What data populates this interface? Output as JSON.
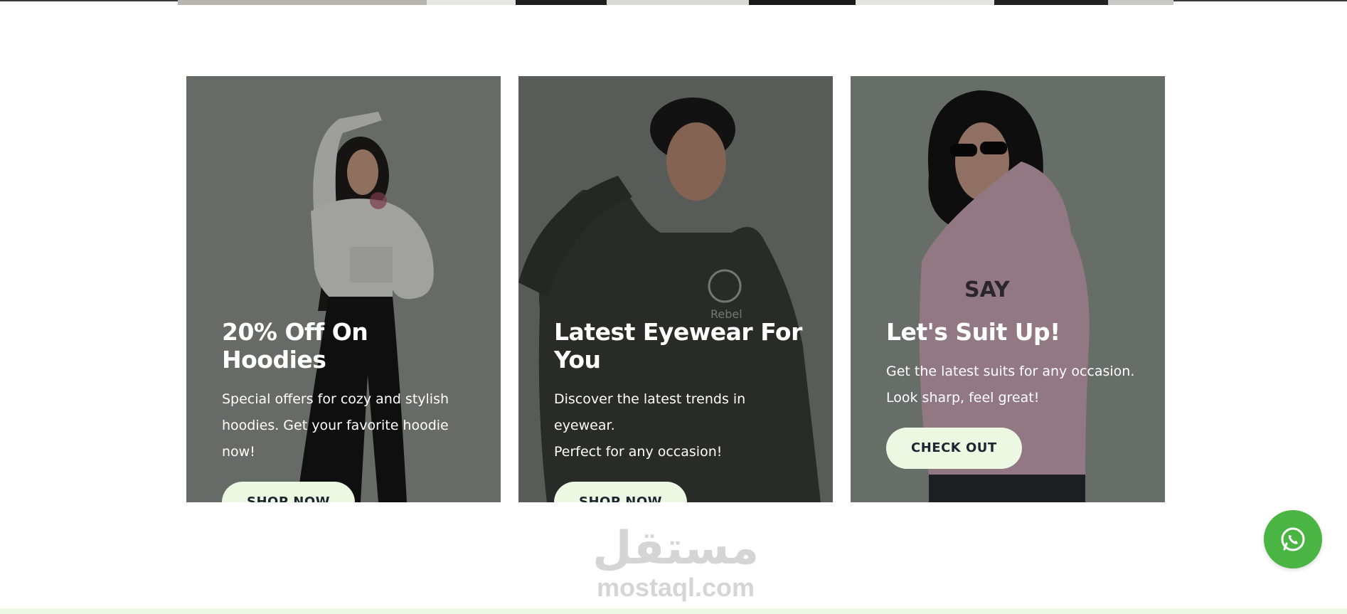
{
  "colors": {
    "button_bg": "#edf8e3",
    "button_text": "#1d2530",
    "whatsapp": "#4bb544",
    "card1_bg": "#8f9590",
    "card2_bg": "#6a6f6a",
    "card3_bg": "#8a9089"
  },
  "cards": [
    {
      "title": "20% Off On Hoodies",
      "desc_line1": "Special offers for cozy and stylish",
      "desc_line2": "hoodies. Get your favorite hoodie now!",
      "button": "SHOP NOW"
    },
    {
      "title": "Latest Eyewear For You",
      "desc_line1": "Discover the latest trends in eyewear.",
      "desc_line2": "Perfect for any occasion!",
      "button": "SHOP NOW"
    },
    {
      "title": "Let's Suit Up!",
      "desc_line1": "Get the latest suits for any occasion.",
      "desc_line2": "Look sharp, feel great!",
      "button": "CHECK OUT"
    }
  ],
  "whatsapp": {
    "icon": "whatsapp-icon"
  },
  "watermark": {
    "arabic": "مستقل",
    "latin": "mostaql.com"
  }
}
